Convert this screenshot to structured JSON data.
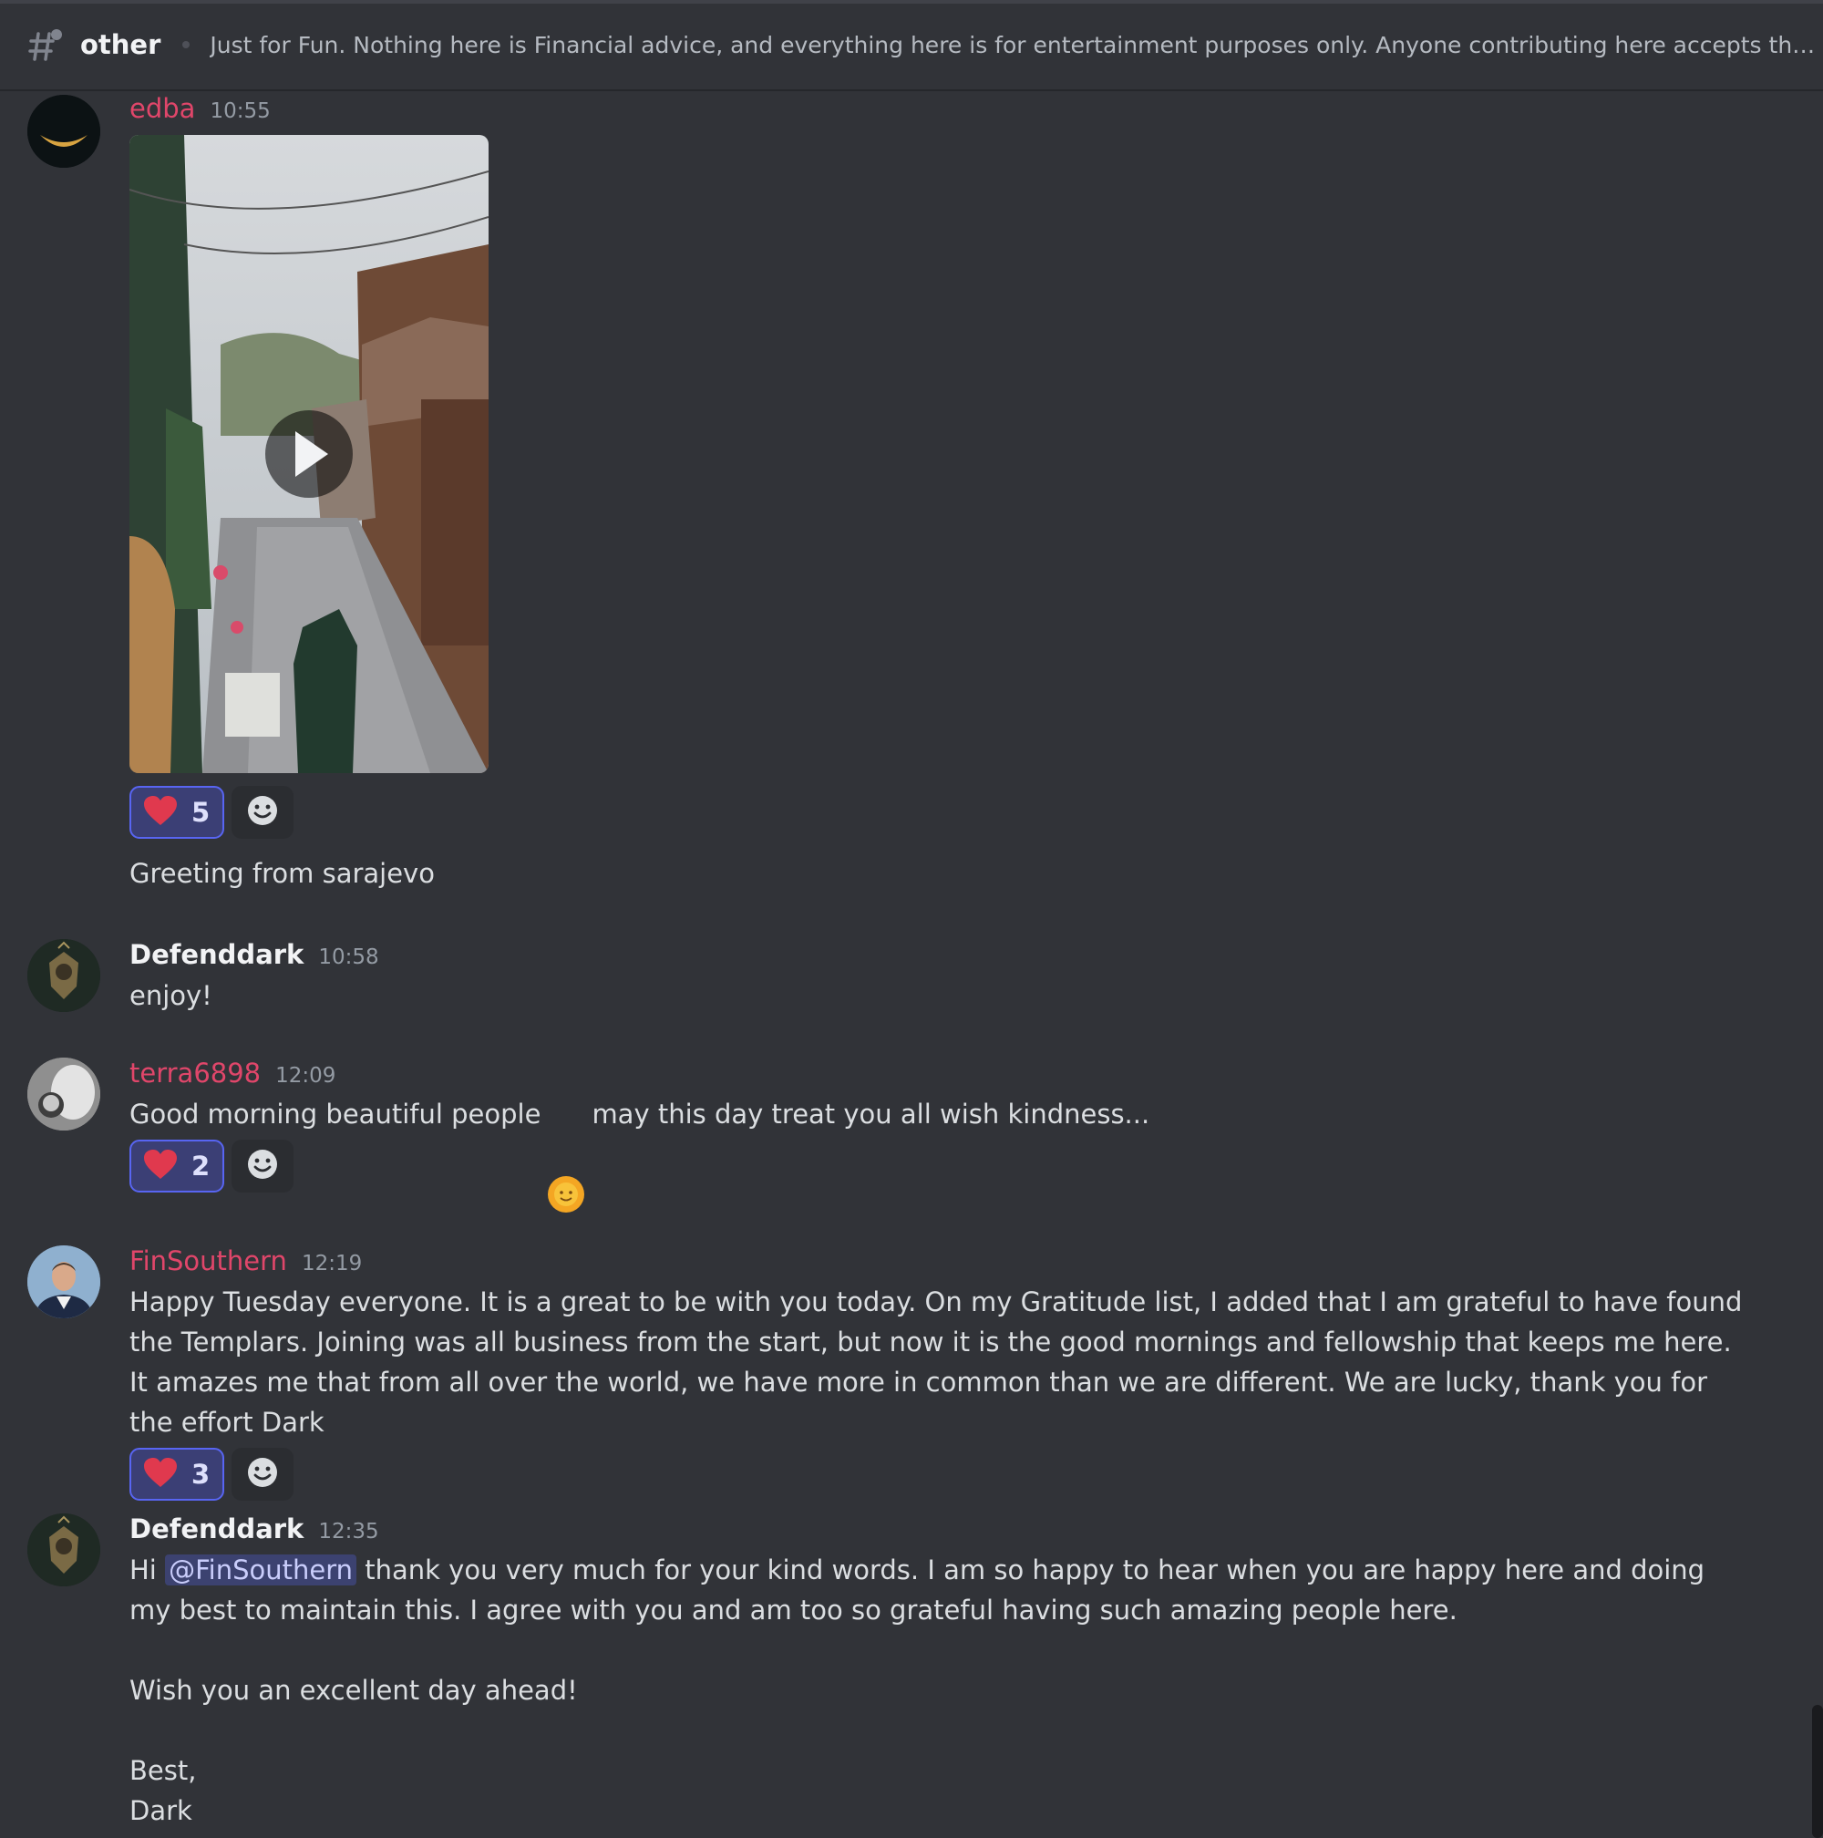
{
  "header": {
    "channel": "other",
    "topic": "Just for Fun. Nothing here is Financial advice, and everything here is for entertainment purposes only. Anyone contributing here accepts these ter..."
  },
  "messages": [
    {
      "username": "edba",
      "time": "10:55",
      "attachment": "video",
      "reaction": {
        "emoji": "heart",
        "count": "5"
      },
      "text": "Greeting from sarajevo"
    },
    {
      "username": "Defenddark",
      "time": "10:58",
      "text": "enjoy!"
    },
    {
      "username": "terra6898",
      "time": "12:09",
      "text_before": "Good morning beautiful people",
      "emoji": "sun-emoji",
      "text_after": "may this day treat you all wish kindness...",
      "reaction": {
        "emoji": "heart",
        "count": "2"
      }
    },
    {
      "username": "FinSouthern",
      "time": "12:19",
      "text": "Happy Tuesday everyone. It is a great to be with you today. On my Gratitude list, I added that I am grateful to have found the Templars. Joining was all business from the start, but now it is the good mornings and fellowship that keeps me here. It amazes me that from all over the world, we have more in common than we are different. We are lucky, thank you for the effort Dark",
      "reaction": {
        "emoji": "heart",
        "count": "3"
      }
    },
    {
      "username": "Defenddark",
      "time": "12:35",
      "text_prefix": "Hi",
      "mention": "@FinSouthern",
      "text_body": "thank you very much for your kind words. I am so happy to hear when you are happy here and doing my best to maintain this. I agree with you and am too so grateful having such amazing people here.",
      "text_wish": "Wish you an excellent day ahead!",
      "text_signoff_1": "Best,",
      "text_signoff_2": "Dark"
    }
  ],
  "colors": {
    "background": "#313338",
    "username_pink": "#e0466a",
    "reaction_border": "#5865f2",
    "reaction_bg": "#3b3f75"
  }
}
